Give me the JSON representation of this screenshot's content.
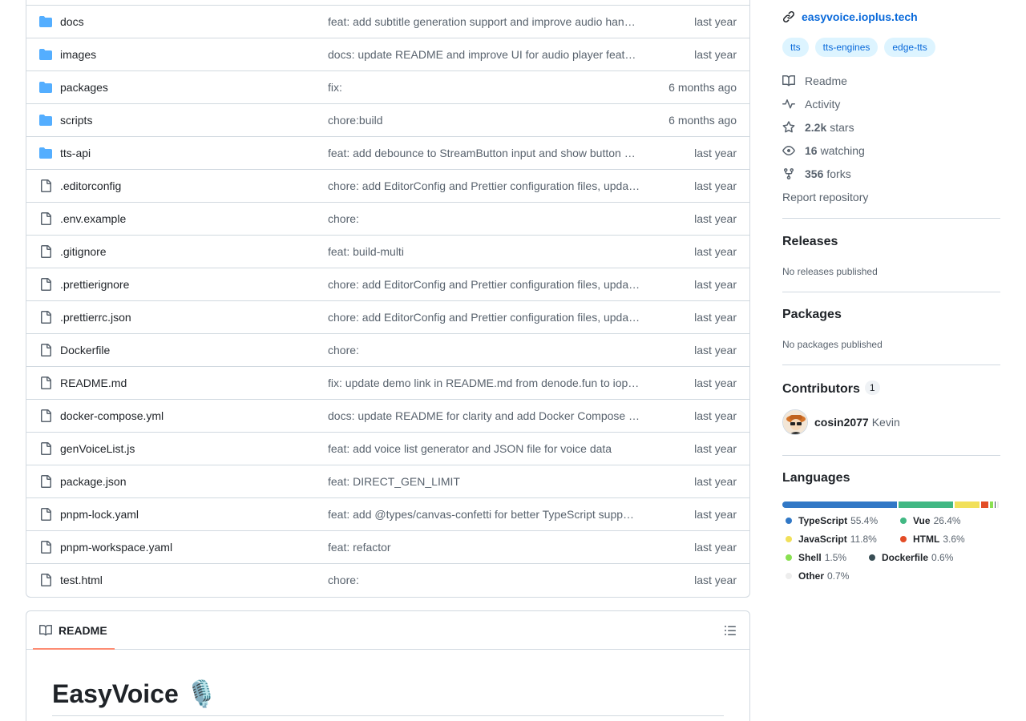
{
  "files": [
    {
      "type": "folder",
      "name": "docs",
      "message": "feat: add subtitle generation support and improve audio han…",
      "date": "last year"
    },
    {
      "type": "folder",
      "name": "images",
      "message": "docs: update README and improve UI for audio player feat…",
      "date": "last year"
    },
    {
      "type": "folder",
      "name": "packages",
      "message": "fix:",
      "date": "6 months ago"
    },
    {
      "type": "folder",
      "name": "scripts",
      "message": "chore:build",
      "date": "6 months ago"
    },
    {
      "type": "folder",
      "name": "tts-api",
      "message": "feat: add debounce to StreamButton input and show button …",
      "date": "last year"
    },
    {
      "type": "file",
      "name": ".editorconfig",
      "message": "chore: add EditorConfig and Prettier configuration files, upda…",
      "date": "last year"
    },
    {
      "type": "file",
      "name": ".env.example",
      "message": "chore:",
      "date": "last year"
    },
    {
      "type": "file",
      "name": ".gitignore",
      "message": "feat: build-multi",
      "date": "last year"
    },
    {
      "type": "file",
      "name": ".prettierignore",
      "message": "chore: add EditorConfig and Prettier configuration files, upda…",
      "date": "last year"
    },
    {
      "type": "file",
      "name": ".prettierrc.json",
      "message": "chore: add EditorConfig and Prettier configuration files, upda…",
      "date": "last year"
    },
    {
      "type": "file",
      "name": "Dockerfile",
      "message": "chore:",
      "date": "last year"
    },
    {
      "type": "file",
      "name": "README.md",
      "message": "fix: update demo link in README.md from denode.fun to iop…",
      "date": "last year"
    },
    {
      "type": "file",
      "name": "docker-compose.yml",
      "message": "docs: update README for clarity and add Docker Compose …",
      "date": "last year"
    },
    {
      "type": "file",
      "name": "genVoiceList.js",
      "message": "feat: add voice list generator and JSON file for voice data",
      "date": "last year"
    },
    {
      "type": "file",
      "name": "package.json",
      "message": "feat: DIRECT_GEN_LIMIT",
      "date": "last year"
    },
    {
      "type": "file",
      "name": "pnpm-lock.yaml",
      "message": "feat: add @types/canvas-confetti for better TypeScript supp…",
      "date": "last year"
    },
    {
      "type": "file",
      "name": "pnpm-workspace.yaml",
      "message": "feat: refactor",
      "date": "last year"
    },
    {
      "type": "file",
      "name": "test.html",
      "message": "chore:",
      "date": "last year"
    }
  ],
  "readme": {
    "tab_label": "README",
    "title": "EasyVoice 🎙️"
  },
  "sidebar": {
    "homepage": "easyvoice.ioplus.tech",
    "topics": [
      "tts",
      "tts-engines",
      "edge-tts"
    ],
    "readme_label": "Readme",
    "activity_label": "Activity",
    "stars_count": "2.2k",
    "stars_label": "stars",
    "watching_count": "16",
    "watching_label": "watching",
    "forks_count": "356",
    "forks_label": "forks",
    "report_label": "Report repository",
    "releases_title": "Releases",
    "releases_empty": "No releases published",
    "packages_title": "Packages",
    "packages_empty": "No packages published",
    "contributors_title": "Contributors",
    "contributors_count": "1",
    "contributor_login": "cosin2077",
    "contributor_name": "Kevin",
    "languages_title": "Languages"
  },
  "languages": [
    {
      "name": "TypeScript",
      "percent": "55.4%",
      "value": 55.4,
      "color": "#3178c6"
    },
    {
      "name": "Vue",
      "percent": "26.4%",
      "value": 26.4,
      "color": "#41b883"
    },
    {
      "name": "JavaScript",
      "percent": "11.8%",
      "value": 11.8,
      "color": "#f1e05a"
    },
    {
      "name": "HTML",
      "percent": "3.6%",
      "value": 3.6,
      "color": "#e34c26"
    },
    {
      "name": "Shell",
      "percent": "1.5%",
      "value": 1.5,
      "color": "#89e051"
    },
    {
      "name": "Dockerfile",
      "percent": "0.6%",
      "value": 0.6,
      "color": "#384d54"
    },
    {
      "name": "Other",
      "percent": "0.7%",
      "value": 0.7,
      "color": "#ededed"
    }
  ],
  "colors": {
    "link": "#0969da",
    "folder": "#54aeff",
    "muted": "#59636e",
    "border": "#d1d9e0",
    "tab_underline": "#fd8c73"
  }
}
